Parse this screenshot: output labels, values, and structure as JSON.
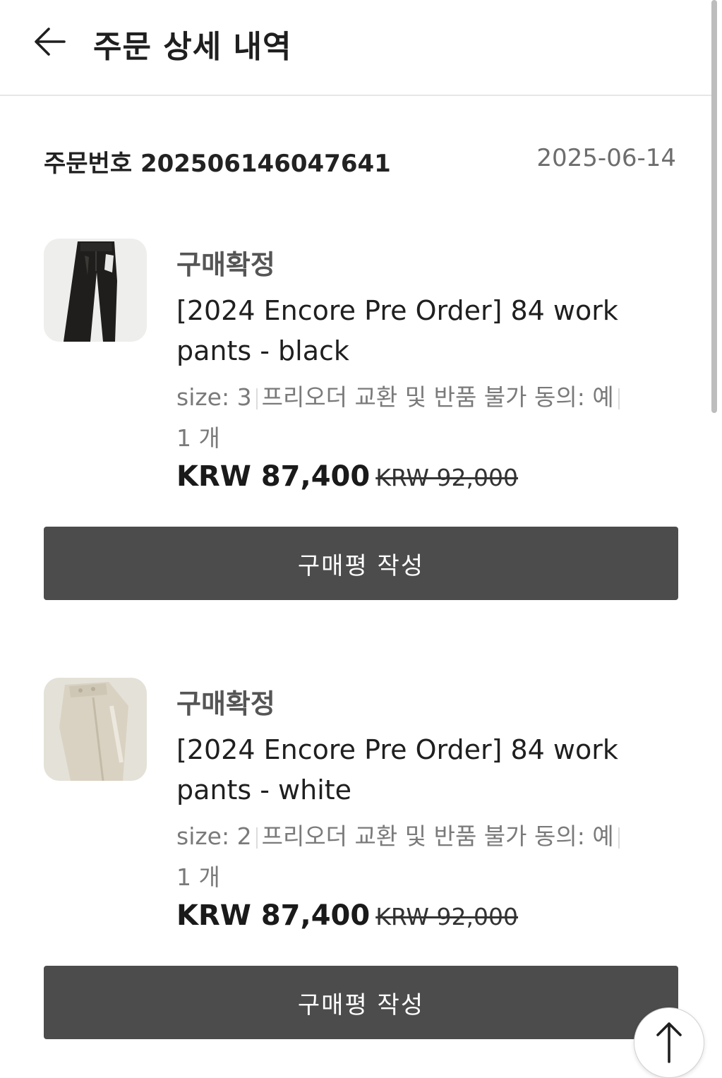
{
  "header": {
    "title": "주문 상세 내역",
    "back_icon": "arrow-left-icon"
  },
  "order": {
    "label_number": "주문번호 202506146047641",
    "date": "2025-06-14"
  },
  "items": [
    {
      "status": "구매확정",
      "name": "[2024 Encore Pre Order] 84 work pants - black",
      "size": "size: 3",
      "option": "프리오더 교환 및 반품 불가 동의: 예",
      "quantity": "1 개",
      "price": "KRW 87,400",
      "original_price": "KRW 92,000",
      "button": "구매평 작성",
      "thumb_colors": {
        "bg": "#eeeeec",
        "garment": "#1f1e1c"
      }
    },
    {
      "status": "구매확정",
      "name": "[2024 Encore Pre Order] 84 work pants - white",
      "size": "size: 2",
      "option": "프리오더 교환 및 반품 불가 동의: 예",
      "quantity": "1 개",
      "price": "KRW 87,400",
      "original_price": "KRW 92,000",
      "button": "구매평 작성",
      "thumb_colors": {
        "bg": "#e4e1d8",
        "garment": "#d9d2c2"
      }
    }
  ],
  "scroll_top_icon": "arrow-up-icon",
  "colors": {
    "button_bg": "#4c4c4c",
    "divider": "#e6e6e6",
    "muted_text": "#7a7a7a"
  }
}
